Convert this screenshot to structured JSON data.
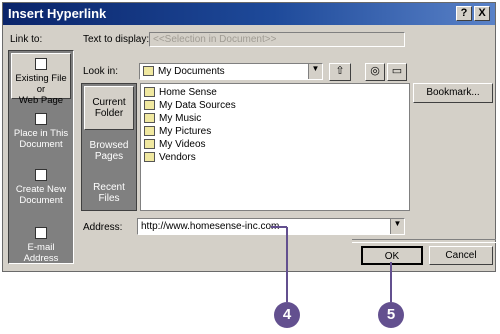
{
  "dialog": {
    "title": "Insert Hyperlink",
    "help_glyph": "?",
    "close_glyph": "X"
  },
  "link_to": {
    "label": "Link to:",
    "items": [
      {
        "line1": "Existing File or",
        "line2": "Web Page",
        "selected": true
      },
      {
        "line1": "Place in This",
        "line2": "Document",
        "selected": false
      },
      {
        "line1": "Create New",
        "line2": "Document",
        "selected": false
      },
      {
        "line1": "E-mail Address",
        "line2": "",
        "selected": false
      }
    ]
  },
  "text_to_display": {
    "label": "Text to display:",
    "value": "<<Selection in Document>>"
  },
  "look_in": {
    "label": "Look in:",
    "value": "My Documents"
  },
  "nav": {
    "items": [
      {
        "line1": "Current",
        "line2": "Folder",
        "selected": true
      },
      {
        "line1": "Browsed",
        "line2": "Pages",
        "selected": false
      },
      {
        "line1": "Recent",
        "line2": "Files",
        "selected": false
      }
    ]
  },
  "files": [
    "Home Sense",
    "My Data Sources",
    "My Music",
    "My Pictures",
    "My Videos",
    "Vendors"
  ],
  "bookmark_button": "Bookmark...",
  "address": {
    "label": "Address:",
    "value": "http://www.homesense-inc.com"
  },
  "buttons": {
    "ok": "OK",
    "cancel": "Cancel"
  },
  "callouts": [
    "4",
    "5"
  ],
  "colors": {
    "title_bar": "#0a246a",
    "dialog_bg": "#d4d0c8",
    "callout": "#63508f"
  }
}
